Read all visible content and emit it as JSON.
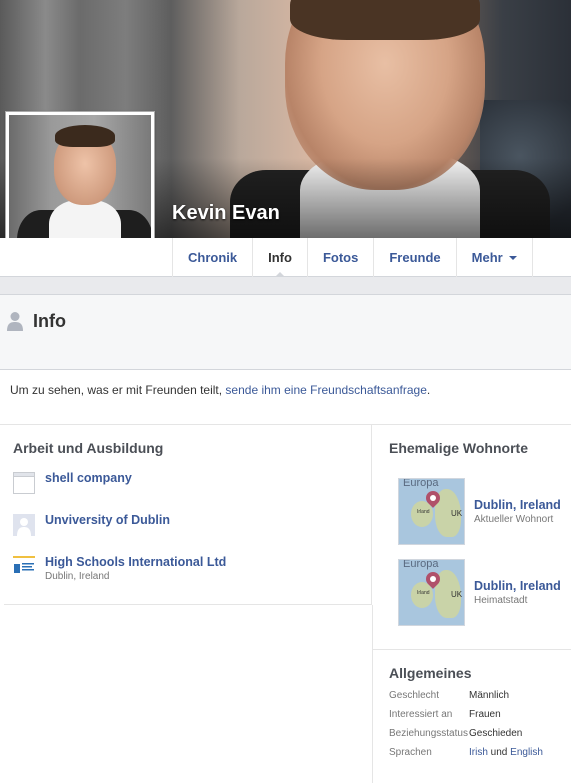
{
  "profile": {
    "name": "Kevin Evan"
  },
  "nav": {
    "tabs": [
      {
        "label": "Chronik"
      },
      {
        "label": "Info"
      },
      {
        "label": "Fotos"
      },
      {
        "label": "Freunde"
      },
      {
        "label": "Mehr"
      }
    ],
    "active": "Info"
  },
  "info": {
    "title": "Info",
    "notice_prefix": "Um zu sehen, was er mit Freunden teilt, ",
    "notice_link": "sende ihm eine Freundschaftsanfrage",
    "notice_suffix": "."
  },
  "work": {
    "title": "Arbeit und Ausbildung",
    "items": [
      {
        "name": "shell company",
        "sub": ""
      },
      {
        "name": "Unviversity of Dublin",
        "sub": ""
      },
      {
        "name": "High Schools International Ltd",
        "sub": "Dublin, Ireland"
      }
    ]
  },
  "places": {
    "title": "Ehemalige Wohnorte",
    "items": [
      {
        "name": "Dublin, Ireland",
        "sub": "Aktueller Wohnort",
        "map_label": "Europa",
        "uk": "UK",
        "irl": "Irland"
      },
      {
        "name": "Dublin, Ireland",
        "sub": "Heimatstadt",
        "map_label": "Europa",
        "uk": "UK",
        "irl": "Irland"
      }
    ]
  },
  "general": {
    "title": "Allgemeines",
    "facts": [
      {
        "key": "Geschlecht",
        "value": "Männlich"
      },
      {
        "key": "Interessiert an",
        "value": "Frauen"
      },
      {
        "key": "Beziehungsstatus",
        "value": "Geschieden"
      },
      {
        "key": "Sprachen",
        "value_a": "Irish",
        "value_and": " und ",
        "value_b": "English"
      }
    ]
  },
  "colors": {
    "link": "#3b5998",
    "page_bg": "#e9eaed"
  }
}
